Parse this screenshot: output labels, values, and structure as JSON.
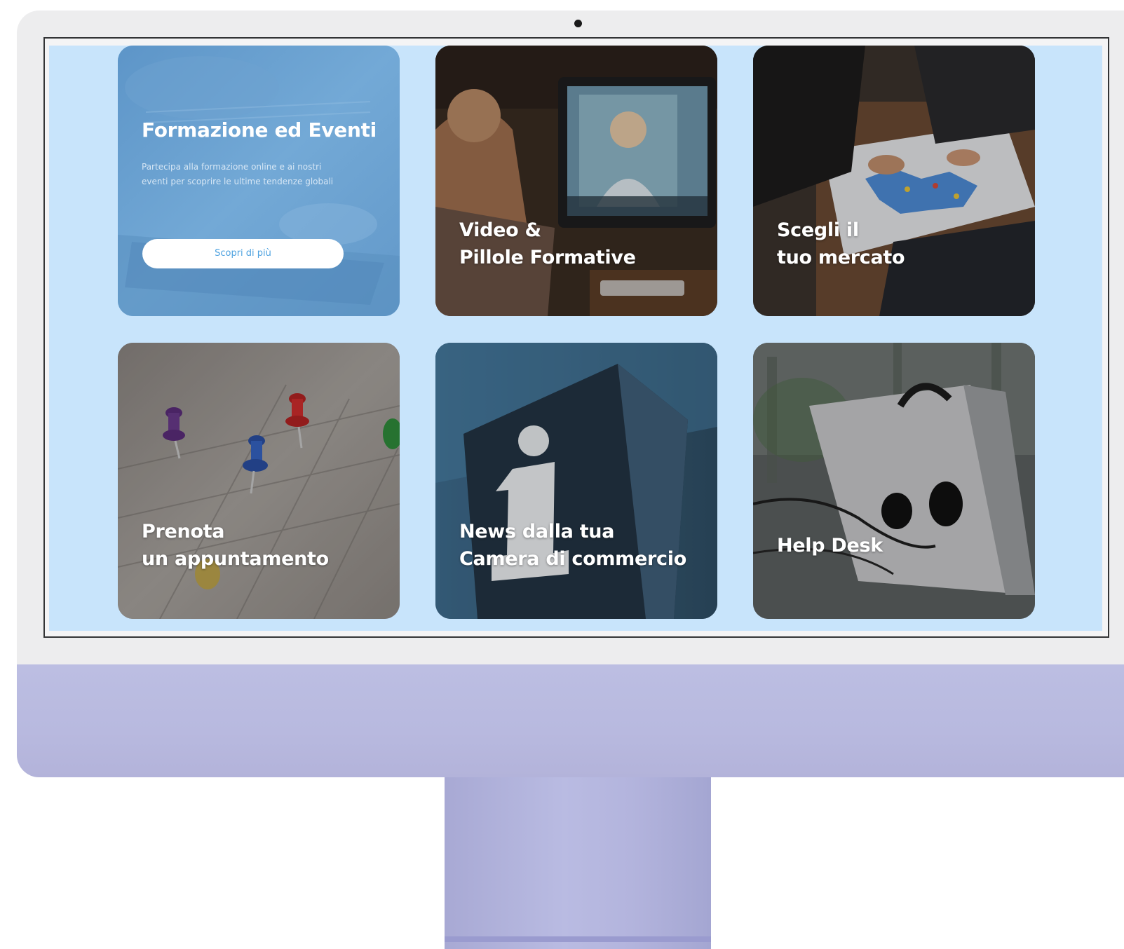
{
  "cards": [
    {
      "title": "Formazione ed Eventi",
      "description": "Partecipa alla formazione online e ai nostri eventi per scoprire le ultime tendenze globali",
      "button_label": "Scopri di più"
    },
    {
      "title": "Video &\nPillole Formative"
    },
    {
      "title": "Scegli il\ntuo mercato"
    },
    {
      "title": "Prenota\nun appuntamento"
    },
    {
      "title": "News dalla tua\nCamera di commercio"
    },
    {
      "title": "Help Desk"
    }
  ],
  "colors": {
    "screen_background": "#c8e4fb",
    "button_text": "#4ea2e0",
    "monitor_chin": "#bcbee2"
  }
}
